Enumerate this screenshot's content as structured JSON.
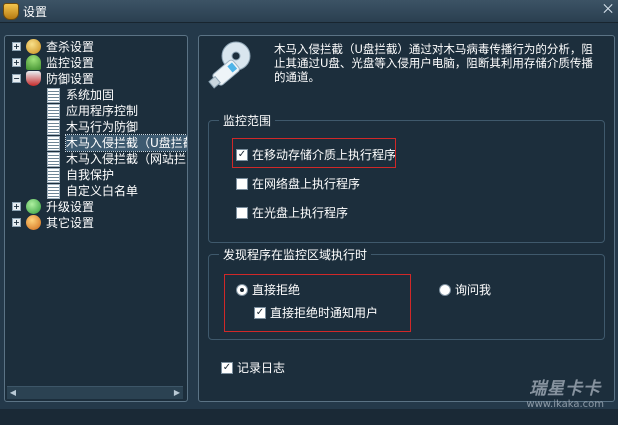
{
  "window": {
    "title": "设置",
    "close_glyph": "⨉"
  },
  "tree": {
    "items": [
      {
        "label": "查杀设置",
        "icon": "scan-icon",
        "expander": "+"
      },
      {
        "label": "监控设置",
        "icon": "umbrella-icon",
        "expander": "+"
      },
      {
        "label": "防御设置",
        "icon": "shield-icon",
        "expander": "−"
      },
      {
        "label": "系统加固",
        "icon": "page-icon"
      },
      {
        "label": "应用程序控制",
        "icon": "page-icon"
      },
      {
        "label": "木马行为防御",
        "icon": "page-icon"
      },
      {
        "label": "木马入侵拦截（U盘拦截",
        "icon": "page-icon",
        "selected": true
      },
      {
        "label": "木马入侵拦截（网站拦",
        "icon": "page-icon"
      },
      {
        "label": "自我保护",
        "icon": "page-icon"
      },
      {
        "label": "自定义白名单",
        "icon": "page-icon"
      },
      {
        "label": "升级设置",
        "icon": "update-icon",
        "expander": "+"
      },
      {
        "label": "其它设置",
        "icon": "gear-icon",
        "expander": "+"
      }
    ]
  },
  "content": {
    "icon": "usb-drive-icon",
    "description": "木马入侵拦截（U盘拦截）通过对木马病毒传播行为的分析，阻止其通过U盘、光盘等入侵用户电脑，阻断其利用存储介质传播的通道。",
    "monitor_scope": {
      "title": "监控范围",
      "options": [
        {
          "label": "在移动存储介质上执行程序",
          "checked": true
        },
        {
          "label": "在网络盘上执行程序",
          "checked": false
        },
        {
          "label": "在光盘上执行程序",
          "checked": false
        }
      ]
    },
    "on_detect": {
      "title": "发现程序在监控区域执行时",
      "radio_reject": {
        "label": "直接拒绝",
        "selected": true
      },
      "radio_ask": {
        "label": "询问我",
        "selected": false
      },
      "notify": {
        "label": "直接拒绝时通知用户",
        "checked": true
      }
    },
    "log": {
      "label": "记录日志",
      "checked": true
    }
  },
  "watermark": {
    "name": "瑞星卡卡",
    "url": "www.ikaka.com"
  },
  "colors": {
    "background": "#24394a",
    "panel": "#1c2e3c",
    "highlight": "#d02828"
  }
}
